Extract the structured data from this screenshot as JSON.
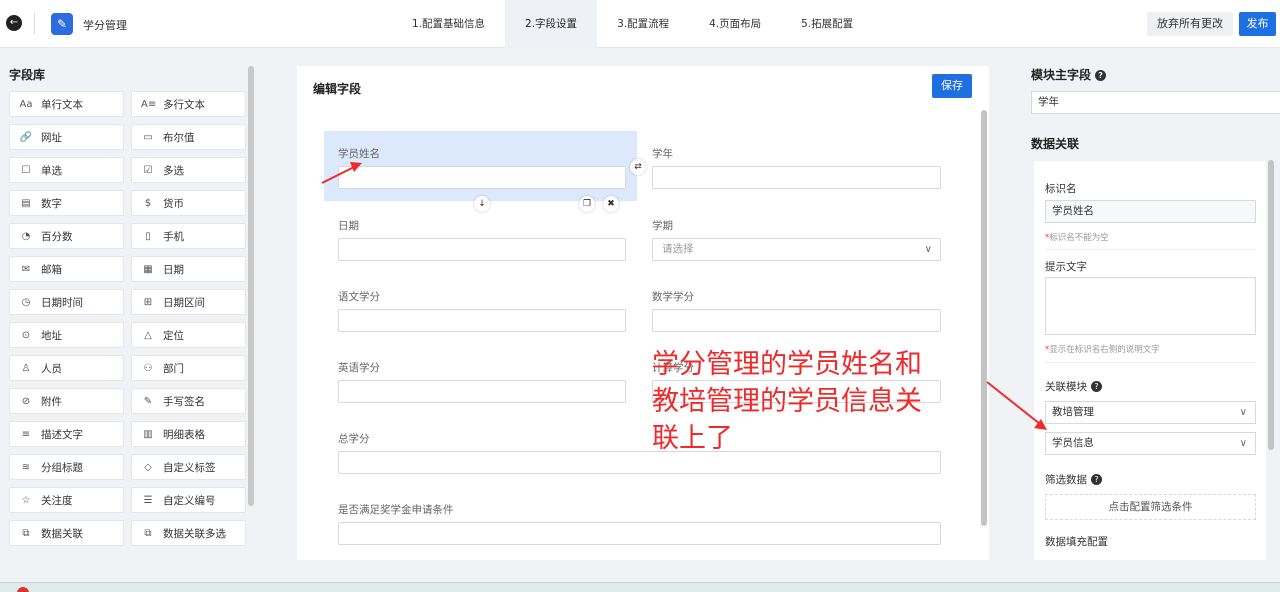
{
  "app": {
    "title": "学分管理"
  },
  "steps": [
    {
      "label": "1.配置基础信息"
    },
    {
      "label": "2.字段设置"
    },
    {
      "label": "3.配置流程"
    },
    {
      "label": "4.页面布局"
    },
    {
      "label": "5.拓展配置"
    }
  ],
  "actions": {
    "discard": "放弃所有更改",
    "publish": "发布"
  },
  "library": {
    "title": "字段库",
    "items": [
      {
        "icon": "Aa",
        "label": "单行文本"
      },
      {
        "icon": "A≡",
        "label": "多行文本"
      },
      {
        "icon": "🔗",
        "label": "网址"
      },
      {
        "icon": "▭",
        "label": "布尔值"
      },
      {
        "icon": "☐",
        "label": "单选"
      },
      {
        "icon": "☑",
        "label": "多选"
      },
      {
        "icon": "▤",
        "label": "数字"
      },
      {
        "icon": "$",
        "label": "货币"
      },
      {
        "icon": "◔",
        "label": "百分数"
      },
      {
        "icon": "▯",
        "label": "手机"
      },
      {
        "icon": "✉",
        "label": "邮箱"
      },
      {
        "icon": "▦",
        "label": "日期"
      },
      {
        "icon": "◷",
        "label": "日期时间"
      },
      {
        "icon": "⊞",
        "label": "日期区间"
      },
      {
        "icon": "⊙",
        "label": "地址"
      },
      {
        "icon": "△",
        "label": "定位"
      },
      {
        "icon": "♙",
        "label": "人员"
      },
      {
        "icon": "⚇",
        "label": "部门"
      },
      {
        "icon": "⊘",
        "label": "附件"
      },
      {
        "icon": "✎",
        "label": "手写签名"
      },
      {
        "icon": "≡",
        "label": "描述文字"
      },
      {
        "icon": "▥",
        "label": "明细表格"
      },
      {
        "icon": "≋",
        "label": "分组标题"
      },
      {
        "icon": "◇",
        "label": "自定义标签"
      },
      {
        "icon": "☆",
        "label": "关注度"
      },
      {
        "icon": "☰",
        "label": "自定义编号"
      },
      {
        "icon": "⧉",
        "label": "数据关联"
      },
      {
        "icon": "⧉",
        "label": "数据关联多选"
      }
    ]
  },
  "editor": {
    "title": "编辑字段",
    "save": "保存",
    "fields": {
      "student_name": "学员姓名",
      "school_year": "学年",
      "date": "日期",
      "semester": "学期",
      "semester_placeholder": "请选择",
      "chinese_credit": "语文学分",
      "math_credit": "数学学分",
      "english_credit": "英语学分",
      "other_credit": "计算学分",
      "total_credit": "总学分",
      "scholarship": "是否满足奖学金申请条件"
    }
  },
  "annotation": {
    "lines": [
      "学分管理的学员姓名和",
      "教培管理的学员信息关",
      "联上了"
    ]
  },
  "right": {
    "main_field_title": "模块主字段",
    "main_field_value": "学年",
    "relation_title": "数据关联",
    "label_name": "标识名",
    "label_value": "学员姓名",
    "label_hint": "标识名不能为空",
    "tip_text": "提示文字",
    "tip_hint": "显示在标识名右侧的说明文字",
    "related_module": "关联模块",
    "module_value": "教培管理",
    "sub_value": "学员信息",
    "filter_data": "筛选数据",
    "filter_button": "点击配置筛选条件",
    "fill_config": "数据填充配置"
  },
  "colors": {
    "accent": "#1e6fe0",
    "annotation": "#ee2a2a",
    "selected": "#dce8fb"
  }
}
